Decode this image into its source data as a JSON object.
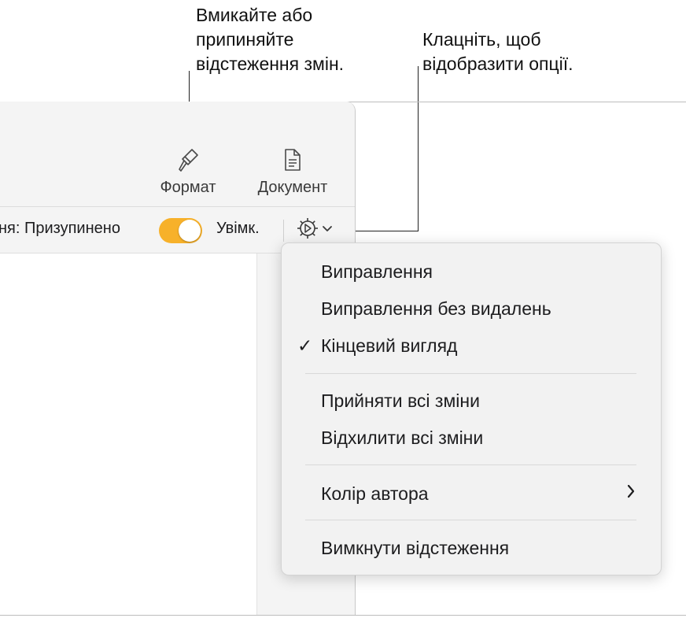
{
  "callouts": {
    "left": "Вмикайте або\nприпиняйте\nвідстеження змін.",
    "right": "Клацніть, щоб\nвідобразити опції."
  },
  "toolbar": {
    "format_label": "Формат",
    "document_label": "Документ"
  },
  "tracking_bar": {
    "label": "ня: Призупинено",
    "toggle_state": "on",
    "toggle_color": "#f7b12a",
    "on_label": "Увімк."
  },
  "menu": {
    "items": [
      {
        "label": "Виправлення",
        "checked": false
      },
      {
        "label": "Виправлення без видалень",
        "checked": false
      },
      {
        "label": "Кінцевий вигляд",
        "checked": true
      },
      {
        "label": "Прийняти всі зміни"
      },
      {
        "label": "Відхилити всі зміни"
      },
      {
        "label": "Колір автора",
        "has_submenu": true
      },
      {
        "label": "Вимкнути відстеження"
      }
    ],
    "check_glyph": "✓"
  }
}
